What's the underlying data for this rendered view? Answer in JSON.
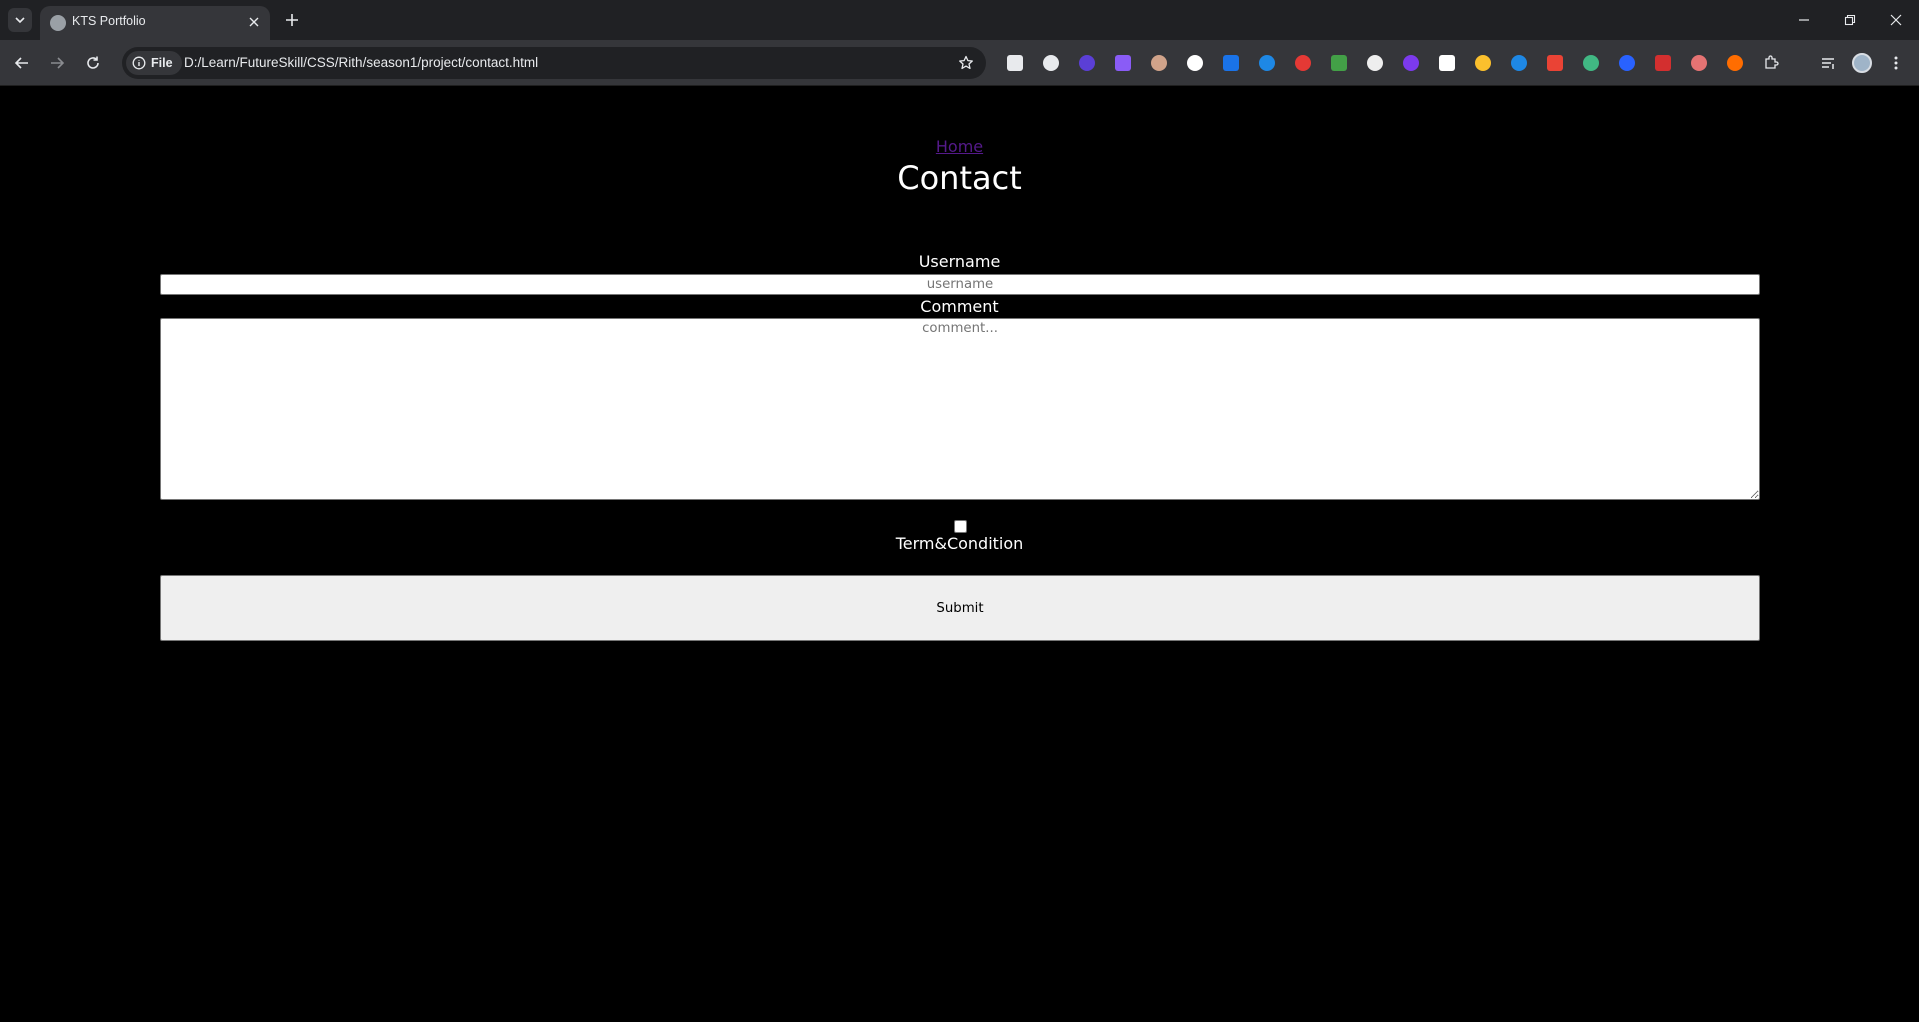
{
  "browser": {
    "tab": {
      "title": "KTS Portfolio"
    },
    "omnibox": {
      "chip_label": "File",
      "url": "D:/Learn/FutureSkill/CSS/Rith/season1/project/contact.html"
    },
    "extensions": [
      {
        "name": "eyedropper-icon",
        "color": "#e8eaed"
      },
      {
        "name": "function-icon",
        "color": "#e8eaed"
      },
      {
        "name": "purple-cube-icon",
        "color": "#5b3fd6"
      },
      {
        "name": "gear-purple-icon",
        "color": "#8a5cf6"
      },
      {
        "name": "face-icon",
        "color": "#d0a38a"
      },
      {
        "name": "circle-l-icon",
        "color": "#ffffff"
      },
      {
        "name": "blue-c-icon",
        "color": "#1a73e8"
      },
      {
        "name": "ft-icon",
        "color": "#1e88e5"
      },
      {
        "name": "calendar-icon",
        "color": "#e53935"
      },
      {
        "name": "colorful-circle-icon",
        "color": "#43a047"
      },
      {
        "name": "ninja-icon",
        "color": "#eeeeee"
      },
      {
        "name": "infinity-icon",
        "color": "#7c3aed"
      },
      {
        "name": "openai-icon",
        "color": "#ffffff"
      },
      {
        "name": "sticky-note-icon",
        "color": "#fbc02d"
      },
      {
        "name": "check-box-icon",
        "color": "#1e88e5"
      },
      {
        "name": "s-box-icon",
        "color": "#ea4335"
      },
      {
        "name": "vue-icon",
        "color": "#41b883"
      },
      {
        "name": "bookmark-blue-icon",
        "color": "#2962ff"
      },
      {
        "name": "bug-icon",
        "color": "#d32f2f"
      },
      {
        "name": "red-dot-icon",
        "color": "#e57373"
      },
      {
        "name": "orange-ball-icon",
        "color": "#ff6d00"
      }
    ]
  },
  "page": {
    "home_link": "Home",
    "title": "Contact",
    "username_label": "Username",
    "username_placeholder": "username",
    "comment_label": "Comment",
    "comment_placeholder": "comment...",
    "terms_label": "Term&Condition",
    "submit_label": "Submit"
  }
}
